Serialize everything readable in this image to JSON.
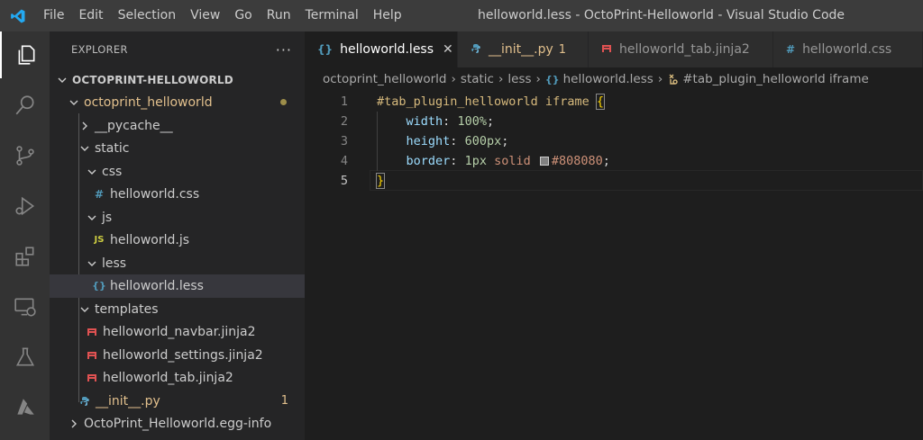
{
  "window_title": "helloworld.less - OctoPrint-Helloworld - Visual Studio Code",
  "menu": [
    "File",
    "Edit",
    "Selection",
    "View",
    "Go",
    "Run",
    "Terminal",
    "Help"
  ],
  "activity_bar": [
    "explorer-icon",
    "search-icon",
    "source-control-icon",
    "run-debug-icon",
    "extensions-icon",
    "remote-explorer-icon",
    "testing-icon",
    "azure-icon"
  ],
  "explorer": {
    "title": "EXPLORER",
    "more": "···",
    "root": "OCTOPRINT-HELLOWORLD",
    "items": [
      {
        "label": "octoprint_helloworld",
        "badge": ""
      },
      {
        "label": "__pycache__"
      },
      {
        "label": "static"
      },
      {
        "label": "css"
      },
      {
        "label": "helloworld.css",
        "icon": "#"
      },
      {
        "label": "js"
      },
      {
        "label": "helloworld.js",
        "icon": "JS"
      },
      {
        "label": "less"
      },
      {
        "label": "helloworld.less",
        "icon": "{}"
      },
      {
        "label": "templates"
      },
      {
        "label": "helloworld_navbar.jinja2"
      },
      {
        "label": "helloworld_settings.jinja2"
      },
      {
        "label": "helloworld_tab.jinja2"
      },
      {
        "label": "__init__.py",
        "badge": "1"
      },
      {
        "label": "OctoPrint_Helloworld.egg-info"
      }
    ]
  },
  "tabs": [
    {
      "label": "helloworld.less",
      "icon": "{}",
      "close": "✕"
    },
    {
      "label": "__init__.py",
      "badge": "1"
    },
    {
      "label": "helloworld_tab.jinja2"
    },
    {
      "label": "helloworld.css",
      "icon": "#"
    }
  ],
  "breadcrumb": {
    "parts": [
      "octoprint_helloworld",
      "static",
      "less",
      "helloworld.less",
      "#tab_plugin_helloworld iframe"
    ],
    "icon": "{}"
  },
  "code": {
    "line_numbers": [
      "1",
      "2",
      "3",
      "4",
      "5"
    ],
    "l1_selector": "#tab_plugin_helloworld iframe",
    "l1_brace": "{",
    "l2_prop": "width",
    "l2_val": "100%",
    "l3_prop": "height",
    "l3_val": "600px",
    "l4_prop": "border",
    "l4_num": "1px",
    "l4_kw": "solid",
    "l4_color": "#808080",
    "l5_brace": "}",
    "colon": ":",
    "semi": ";"
  },
  "colors": {
    "accent_blue": "#3794ff",
    "modified": "#e2c08d",
    "jinja_red": "#e05252",
    "python_blue": "#519aba"
  }
}
